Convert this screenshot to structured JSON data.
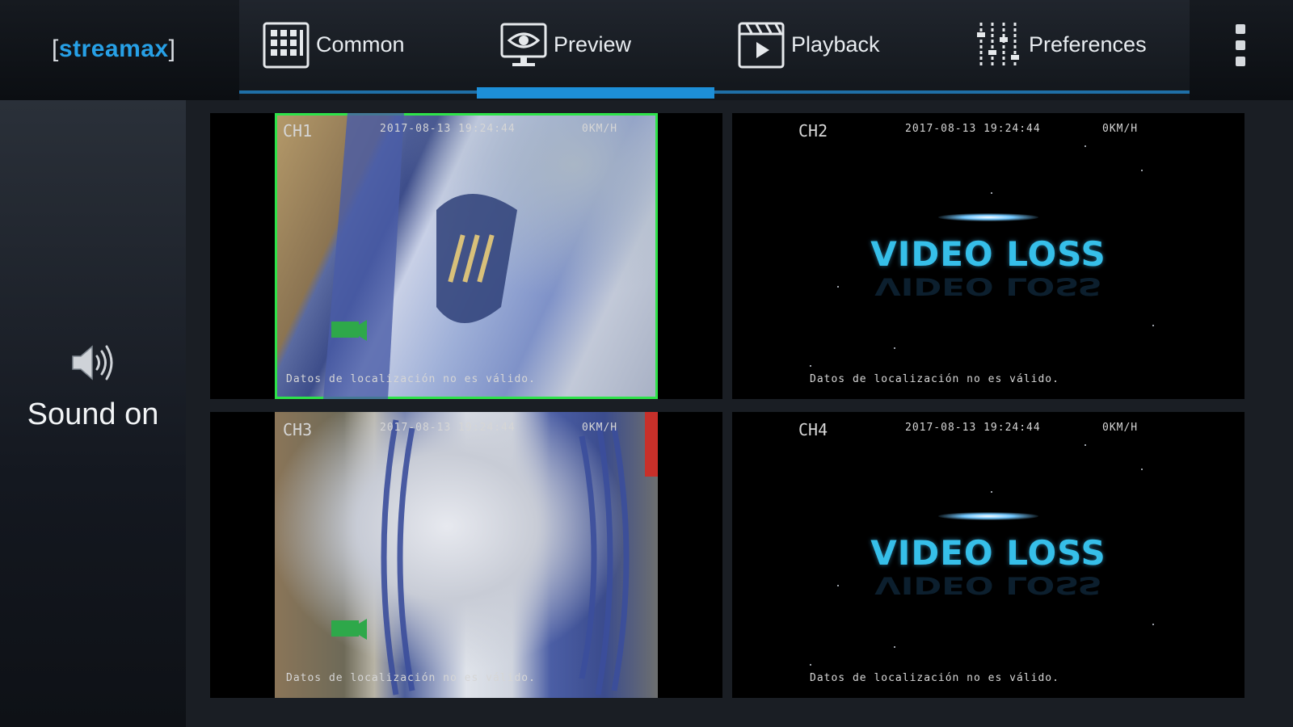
{
  "brand": {
    "name": "streamax",
    "bracket_left": "[",
    "bracket_right": "]"
  },
  "tabs": [
    {
      "label": "Common",
      "icon": "grid-icon",
      "active": false
    },
    {
      "label": "Preview",
      "icon": "eye-monitor-icon",
      "active": true
    },
    {
      "label": "Playback",
      "icon": "clapperboard-play-icon",
      "active": false
    },
    {
      "label": "Preferences",
      "icon": "sliders-icon",
      "active": false
    }
  ],
  "menu": {
    "icon": "more-vertical-icon"
  },
  "side": {
    "sound_label": "Sound on",
    "icon": "speaker-icon"
  },
  "channels": [
    {
      "id": "CH1",
      "datetime": "2017-08-13 19:24:44",
      "speed": "0KM/H",
      "status": "Datos de localización no es válido.",
      "video_loss": false,
      "selected": true
    },
    {
      "id": "CH2",
      "datetime": "2017-08-13 19:24:44",
      "speed": "0KM/H",
      "status": "Datos de localización no es válido.",
      "video_loss": true,
      "loss_text": "VIDEO LOSS"
    },
    {
      "id": "CH3",
      "datetime": "2017-08-13 19:24:44",
      "speed": "0KM/H",
      "status": "Datos de localización no es válido.",
      "video_loss": false
    },
    {
      "id": "CH4",
      "datetime": "2017-08-13 19:24:44",
      "speed": "0KM/H",
      "status": "Datos de localización no es válido.",
      "video_loss": true,
      "loss_text": "VIDEO LOSS"
    }
  ],
  "colors": {
    "accent": "#1d8fd8",
    "brand": "#27a0e6",
    "selection": "#2ee34a",
    "video_loss": "#36bfe9"
  }
}
